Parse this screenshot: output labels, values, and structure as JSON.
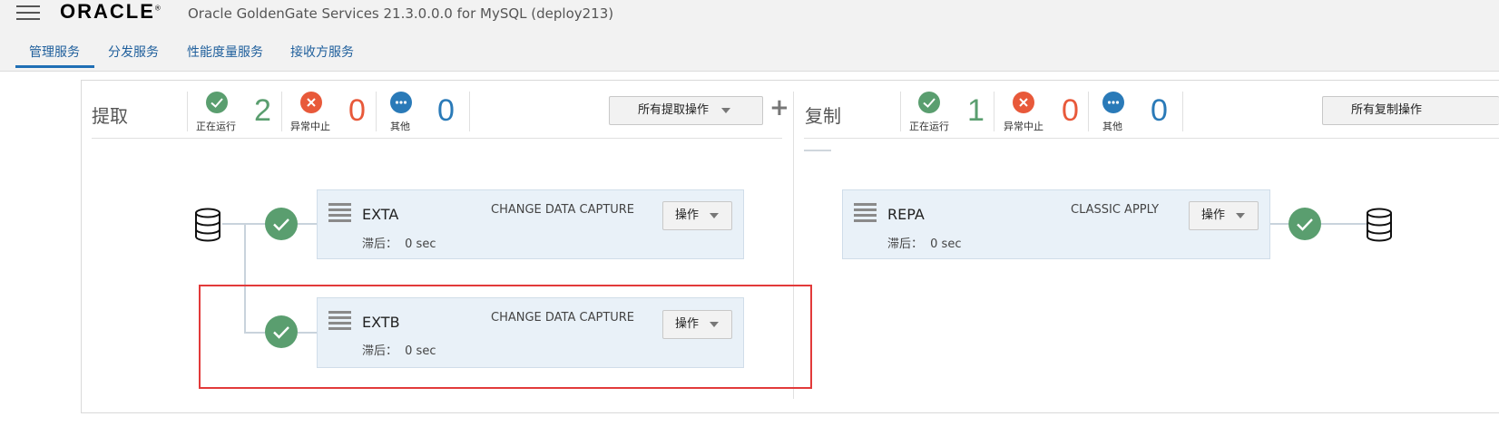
{
  "header": {
    "logo": "ORACLE",
    "logo_mark": "®",
    "title": "Oracle GoldenGate Services 21.3.0.0.0 for MySQL (deploy213)",
    "tabs": [
      {
        "label": "管理服务",
        "active": true
      },
      {
        "label": "分发服务",
        "active": false
      },
      {
        "label": "性能度量服务",
        "active": false
      },
      {
        "label": "接收方服务",
        "active": false
      }
    ]
  },
  "extract": {
    "title": "提取",
    "stats": {
      "running_label": "正在运行",
      "running_count": "2",
      "abended_label": "异常中止",
      "abended_count": "0",
      "other_label": "其他",
      "other_count": "0"
    },
    "actions_label": "所有提取操作",
    "add_symbol": "+",
    "processes": [
      {
        "name": "EXTA",
        "type": "CHANGE DATA CAPTURE",
        "lag_label": "滞后：",
        "lag_value": "0 sec",
        "action_label": "操作",
        "status": "running"
      },
      {
        "name": "EXTB",
        "type": "CHANGE DATA CAPTURE",
        "lag_label": "滞后：",
        "lag_value": "0 sec",
        "action_label": "操作",
        "status": "running"
      }
    ]
  },
  "replicat": {
    "title": "复制",
    "stats": {
      "running_label": "正在运行",
      "running_count": "1",
      "abended_label": "异常中止",
      "abended_count": "0",
      "other_label": "其他",
      "other_count": "0"
    },
    "actions_label": "所有复制操作",
    "processes": [
      {
        "name": "REPA",
        "type": "CLASSIC APPLY",
        "lag_label": "滞后：",
        "lag_value": "0 sec",
        "action_label": "操作",
        "status": "running"
      }
    ]
  },
  "colors": {
    "running": "#5a9e6f",
    "abended": "#e8593a",
    "other": "#2a7ab8",
    "highlight": "#e23a3a",
    "tab_accent": "#1f6fb5"
  },
  "icons": [
    "menu-icon",
    "check-icon",
    "x-icon",
    "more-icon",
    "database-icon",
    "drag-handle-icon",
    "caret-down-icon",
    "plus-icon"
  ]
}
